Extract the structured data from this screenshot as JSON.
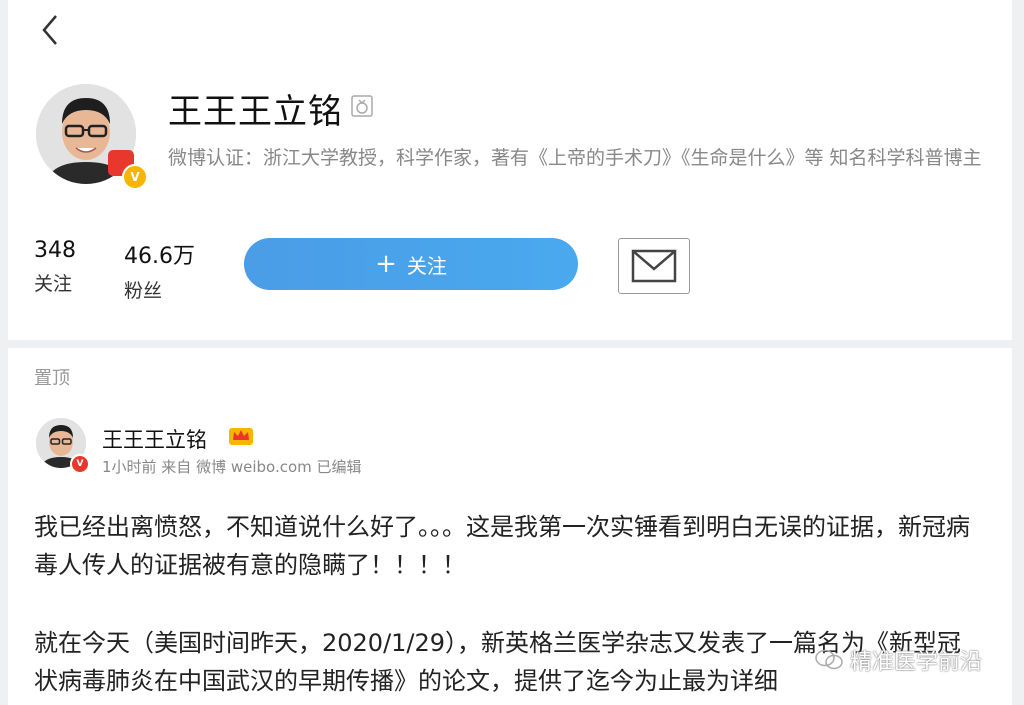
{
  "profile": {
    "name": "王王王立铭",
    "verification": "微博认证：浙江大学教授，科学作家，著有《上帝的手术刀》《生命是什么》等 知名科学科普博主",
    "stats": [
      {
        "value": "348",
        "label": "关注"
      },
      {
        "value": "46.6万",
        "label": "粉丝"
      }
    ],
    "follow_plus": "+",
    "follow_label": "关注"
  },
  "post": {
    "pinned_label": "置顶",
    "author": "王王王立铭",
    "meta": "1小时前 来自 微博 weibo.com 已编辑",
    "paragraph1": "我已经出离愤怒，不知道说什么好了。。。这是我第一次实锤看到明白无误的证据，新冠病毒人传人的证据被有意的隐瞒了！！！！",
    "paragraph2": "就在今天（美国时间昨天，2020/1/29），新英格兰医学杂志又发表了一篇名为《新型冠状病毒肺炎在中国武汉的早期传播》的论文，提供了迄今为止最为详细"
  },
  "badges": {
    "verified_v": "V"
  },
  "watermark": {
    "text": "精准医学前沿"
  },
  "icons": {
    "back": "chevron-left-icon",
    "mail": "mail-icon",
    "crown": "crown-icon",
    "name_badge": "ring-icon"
  },
  "colors": {
    "accent": "#4aa3ea",
    "verified": "#f7b500",
    "red_badge": "#e8372c"
  }
}
